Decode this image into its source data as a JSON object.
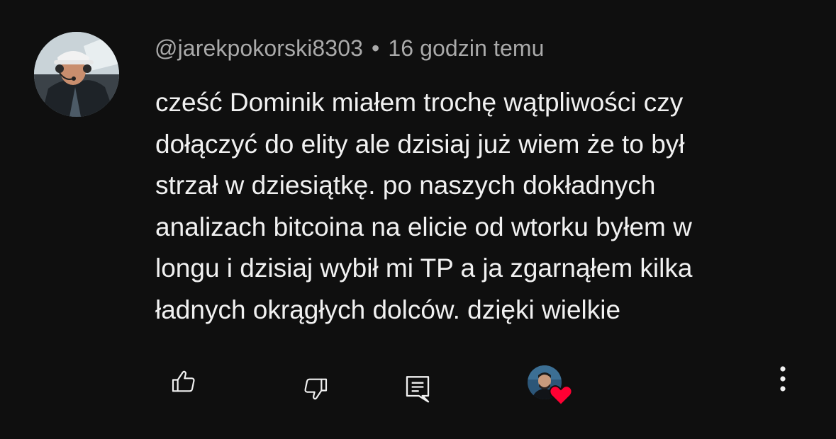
{
  "comment": {
    "author": "@jarekpokorski8303",
    "separator": "•",
    "timestamp": "16 godzin temu",
    "text_lines": [
      "cześć Dominik miałem trochę wątpliwości czy",
      "dołączyć do elity ale dzisiaj już wiem że to był",
      "strzał w dziesiątkę. po naszych dokładnych",
      "analizach bitcoina na elicie od wtorku byłem w",
      "longu i dzisiaj wybił mi TP a ja zgarnąłem kilka",
      "ładnych okrągłych dolców. dzięki wielkie"
    ]
  },
  "actions": {
    "like_icon": "thumb-up-icon",
    "dislike_icon": "thumb-down-icon",
    "reply_icon": "comment-icon",
    "creator_heart_icon": "heart-icon",
    "more_icon": "more-vertical-icon"
  },
  "colors": {
    "background": "#0f0f0f",
    "text_primary": "#f1f1f1",
    "text_secondary": "#aaaaaa",
    "heart": "#ff0033"
  }
}
